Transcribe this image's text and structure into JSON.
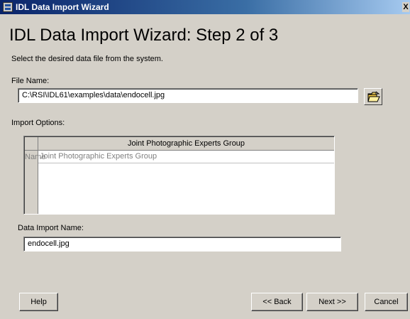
{
  "window": {
    "title": "IDL Data Import Wizard",
    "close_glyph": "X"
  },
  "heading": "IDL Data Import Wizard: Step 2 of 3",
  "instruction": "Select the desired data file from the system.",
  "file_name": {
    "label": "File Name:",
    "value": "C:\\RSI\\IDL61\\examples\\data\\endocell.jpg",
    "browse_icon": "open-folder-icon"
  },
  "import_options": {
    "label": "Import Options:",
    "column_header": "Joint Photographic Experts Group",
    "rows": [
      {
        "header": "Name",
        "value": "Joint Photographic Experts Group"
      }
    ]
  },
  "data_import_name": {
    "label": "Data Import Name:",
    "value": "endocell.jpg"
  },
  "buttons": {
    "help": "Help",
    "back": "<< Back",
    "next": "Next >>",
    "cancel": "Cancel"
  }
}
